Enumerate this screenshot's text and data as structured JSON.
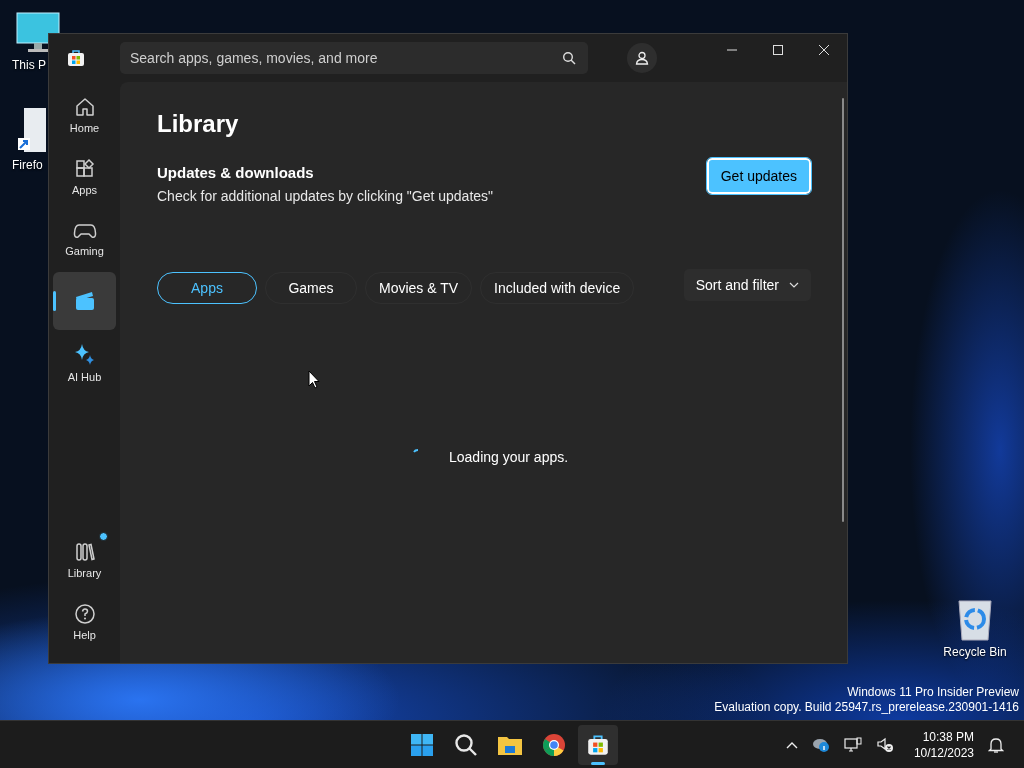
{
  "desktop": {
    "icons": [
      {
        "kind": "pc",
        "label": "This P"
      },
      {
        "kind": "firefox",
        "label": "Firefo"
      },
      {
        "kind": "recycle",
        "label": "Recycle Bin"
      }
    ],
    "edition_notice": [
      "Windows 11 Pro Insider Preview",
      "Evaluation copy. Build 25947.rs_prerelease.230901-1416"
    ]
  },
  "window": {
    "search": {
      "placeholder": "Search apps, games, movies, and more"
    },
    "nav": [
      {
        "kind": "home",
        "label": "Home",
        "selected": false
      },
      {
        "kind": "apps",
        "label": "Apps",
        "selected": false
      },
      {
        "kind": "gaming",
        "label": "Gaming",
        "selected": false
      },
      {
        "kind": "movies",
        "selected": true
      },
      {
        "kind": "aihub",
        "label": "AI Hub",
        "selected": false
      },
      {
        "kind": "library",
        "label": "Library",
        "selected": false,
        "badge": true
      },
      {
        "kind": "help",
        "label": "Help",
        "selected": false
      }
    ],
    "page": {
      "title": "Library",
      "section_title": "Updates & downloads",
      "section_text": "Check for additional updates by clicking \"Get updates\"",
      "primary_button": "Get updates",
      "filters": [
        {
          "label": "Apps",
          "selected": true
        },
        {
          "label": "Games",
          "selected": false
        },
        {
          "label": "Movies & TV",
          "selected": false
        },
        {
          "label": "Included with device",
          "selected": false
        }
      ],
      "sort_button": "Sort and filter",
      "loading_text": "Loading your apps."
    }
  },
  "taskbar": {
    "apps": [
      {
        "kind": "start",
        "selected": false
      },
      {
        "kind": "search",
        "selected": false
      },
      {
        "kind": "explorer",
        "selected": false
      },
      {
        "kind": "chrome",
        "selected": false
      },
      {
        "kind": "store",
        "selected": true
      }
    ],
    "time": "10:38 PM",
    "date": "10/12/2023"
  }
}
